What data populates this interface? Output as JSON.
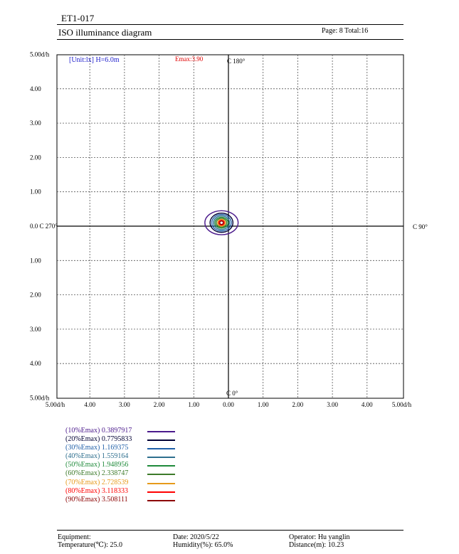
{
  "header": {
    "id": "ET1-017",
    "title": "ISO illuminance diagram",
    "page": "Page: 8  Total:16"
  },
  "plot": {
    "unit_label": "[Unit:lx]  H=6.0m",
    "emax_label": "Emax:3.90",
    "axis_labels": {
      "top": "C 180°",
      "bottom": "C 0°",
      "left": "0.0 C 270°",
      "right": "C 90°"
    },
    "y_ticks": [
      "5.00d/h",
      "4.00",
      "3.00",
      "2.00",
      "1.00",
      "0.0 C 270°",
      "1.00",
      "2.00",
      "3.00",
      "4.00",
      "5.00d/h"
    ],
    "x_ticks": [
      "5.00d/h",
      "4.00",
      "3.00",
      "2.00",
      "1.00",
      "0.00",
      "1.00",
      "2.00",
      "3.00",
      "4.00",
      "5.00d/h"
    ]
  },
  "chart_data": {
    "type": "contour",
    "title": "ISO illuminance diagram",
    "unit": "lx",
    "mounting_height": "H=6.0m",
    "emax": 3.9,
    "xlim": [
      -5,
      5
    ],
    "ylim": [
      -5,
      5
    ],
    "grid": true,
    "center": [
      -0.2,
      0.1
    ],
    "levels": [
      {
        "label": "(10%Emax) 0.3897917",
        "value": 0.3897917,
        "color": "#4b1a8c",
        "rx": 0.48,
        "ry": 0.35
      },
      {
        "label": "(20%Emax) 0.7795833",
        "value": 0.7795833,
        "color": "#000033",
        "rx": 0.33,
        "ry": 0.28
      },
      {
        "label": "(30%Emax) 1.169375",
        "value": 1.169375,
        "color": "#1f5fa8",
        "rx": 0.28,
        "ry": 0.24
      },
      {
        "label": "(40%Emax) 1.559164",
        "value": 1.559164,
        "color": "#2e6f8e",
        "rx": 0.23,
        "ry": 0.2
      },
      {
        "label": "(50%Emax) 1.948956",
        "value": 1.948956,
        "color": "#1f8a3a",
        "rx": 0.19,
        "ry": 0.16
      },
      {
        "label": "(60%Emax) 2.338747",
        "value": 2.338747,
        "color": "#3d7a2a",
        "rx": 0.15,
        "ry": 0.13
      },
      {
        "label": "(70%Emax) 2.728539",
        "value": 2.728539,
        "color": "#e69a1a",
        "rx": 0.11,
        "ry": 0.1
      },
      {
        "label": "(80%Emax) 3.118333",
        "value": 3.118333,
        "color": "#ff0000",
        "rx": 0.08,
        "ry": 0.07
      },
      {
        "label": "(90%Emax) 3.508111",
        "value": 3.508111,
        "color": "#8b0000",
        "rx": 0.05,
        "ry": 0.05
      }
    ]
  },
  "footer": {
    "equipment": "Equipment:",
    "temperature": "Temperature(℃): 25.0",
    "date": "Date: 2020/5/22",
    "humidity": "Humidity(%): 65.0%",
    "operator": "Operator: Hu yanglin",
    "distance": "Distance(m): 10.23"
  }
}
